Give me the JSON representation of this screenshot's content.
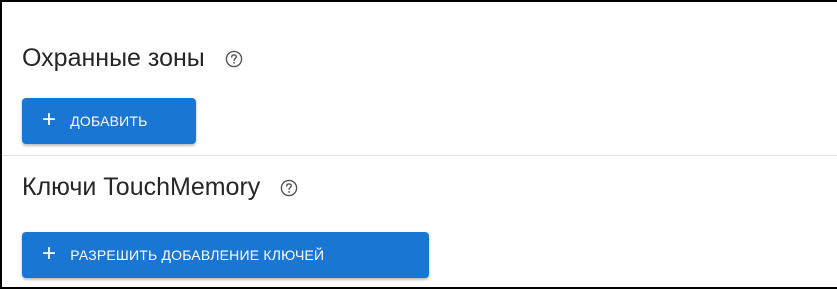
{
  "zones": {
    "title": "Охранные зоны",
    "help_icon": "help-circle-icon",
    "add_button": {
      "icon": "plus-icon",
      "icon_glyph": "+",
      "label": "ДОБАВИТЬ"
    }
  },
  "keys": {
    "title": "Ключи TouchMemory",
    "help_icon": "help-circle-icon",
    "allow_button": {
      "icon": "plus-icon",
      "icon_glyph": "+",
      "label": "РАЗРЕШИТЬ ДОБАВЛЕНИЕ КЛЮЧЕЙ"
    }
  },
  "colors": {
    "primary": "#1976d2",
    "divider": "#e0e0e0",
    "text": "#262626",
    "icon": "#555555"
  }
}
